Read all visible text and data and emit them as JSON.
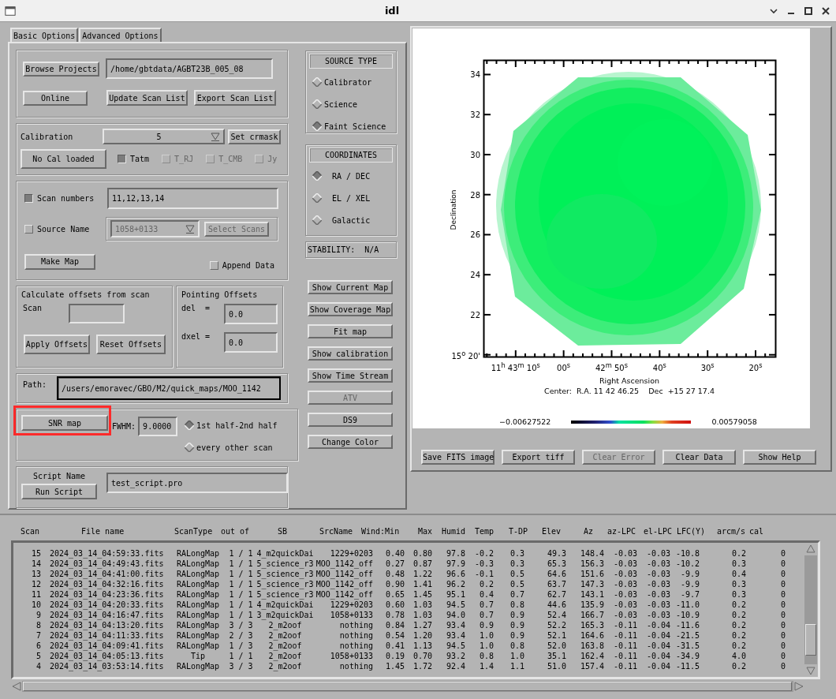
{
  "window": {
    "title": "idl"
  },
  "tabs": [
    {
      "label": "Basic Options",
      "selected": true
    },
    {
      "label": "Advanced Options",
      "selected": false
    }
  ],
  "project": {
    "browse_button": "Browse Projects",
    "path": "/home/gbtdata/AGBT23B_005_08",
    "online_button": "Online",
    "update_button": "Update Scan List",
    "export_button": "Export Scan List"
  },
  "calibration": {
    "label": "Calibration",
    "value": "5",
    "crmask_button": "Set crmask",
    "cal_button": "No Cal loaded",
    "units": [
      {
        "label": "Tatm",
        "checked": true,
        "disabled": false
      },
      {
        "label": "T_RJ",
        "checked": false,
        "disabled": true
      },
      {
        "label": "T_CMB",
        "checked": false,
        "disabled": true
      },
      {
        "label": "Jy",
        "checked": false,
        "disabled": true
      }
    ]
  },
  "scan_numbers": {
    "label": "Scan numbers",
    "checked": true,
    "value": "11,12,13,14"
  },
  "source_name": {
    "label": "Source Name",
    "checked": false,
    "value": "1058+0133",
    "select_button": "Select Scans",
    "disabled": true
  },
  "make_map_button": "Make Map",
  "append_data": {
    "label": "Append Data",
    "checked": false
  },
  "offsets": {
    "title": "Calculate offsets from scan",
    "scan_label": "Scan",
    "apply_button": "Apply Offsets",
    "reset_button": "Reset Offsets"
  },
  "pointing": {
    "title": "Pointing Offsets",
    "fields": [
      {
        "label": "del  =",
        "value": "0.0"
      },
      {
        "label": "dxel =",
        "value": "0.0"
      }
    ]
  },
  "path": {
    "label": "Path:",
    "value": "/users/emoravec/GBO/M2/quick_maps/MOO_1142"
  },
  "snr": {
    "button": "SNR map",
    "highlighted": true,
    "fwhm_label": "FWHM:",
    "fwhm_value": "9.0000",
    "modes": [
      {
        "label": "1st half-2nd half",
        "selected": true
      },
      {
        "label": "every other scan",
        "selected": false
      }
    ]
  },
  "script": {
    "label": "Script Name",
    "value": "test_script.pro",
    "run_button": "Run Script"
  },
  "source_type": {
    "title": "SOURCE TYPE",
    "options": [
      {
        "label": "Calibrator",
        "selected": false
      },
      {
        "label": "Science",
        "selected": false
      },
      {
        "label": "Faint Science",
        "selected": true
      }
    ]
  },
  "coordinates": {
    "title": "COORDINATES",
    "options": [
      {
        "label": "RA / DEC",
        "selected": true
      },
      {
        "label": "EL / XEL",
        "selected": false
      },
      {
        "label": "Galactic",
        "selected": false
      }
    ]
  },
  "stability": "STABILITY:  N/A",
  "side_buttons": [
    {
      "label": "Show Current Map",
      "disabled": false
    },
    {
      "label": "Show Coverage Map",
      "disabled": false
    },
    {
      "label": "Fit map",
      "disabled": false
    },
    {
      "label": "Show calibration",
      "disabled": false
    },
    {
      "label": "Show Time Stream",
      "disabled": false
    },
    {
      "label": "ATV",
      "disabled": true
    },
    {
      "label": "DS9",
      "disabled": false
    },
    {
      "label": "Change Color",
      "disabled": false
    }
  ],
  "map_plot": {
    "ylabel": "Declination",
    "xlabel": "Right Ascension",
    "yticks": [
      "34",
      "32",
      "30",
      "28",
      "26",
      "24",
      "22",
      "15$^{o}$ 20'"
    ],
    "xticks": [
      "11$^{h}$ 43$^{m}$ 10$^{s}$",
      "00$^{s}$",
      "42$^{m}$ 50$^{s}$",
      "40$^{s}$",
      "30$^{s}$",
      "20$^{s}$"
    ],
    "center": "Center:  R.A. 11 42 46.25    Dec  +15 27 17.4",
    "colorbar": {
      "min": "−0.00627522",
      "max": "0.00579058"
    }
  },
  "plot_buttons": [
    {
      "label": "Save FITS image",
      "disabled": false
    },
    {
      "label": "Export tiff",
      "disabled": false
    },
    {
      "label": "Clear Error",
      "disabled": true
    },
    {
      "label": "Clear Data",
      "disabled": false
    },
    {
      "label": "Show Help",
      "disabled": false
    }
  ],
  "scan_table": {
    "columns": [
      "Scan",
      "File name",
      "ScanType",
      "out of",
      "SB",
      "SrcName",
      "Wind:Min",
      "Max",
      "Humid",
      "Temp",
      "T-DP",
      "Elev",
      "Az",
      "az-LPC",
      "el-LPC",
      "LFC(Y)",
      "arcm/s",
      "cal"
    ],
    "rows": [
      [
        "15",
        "2024_03_14_04:59:33.fits",
        "RALongMap",
        "1 / 1",
        "4_m2quickDai",
        "1229+0203",
        "0.40",
        "0.80",
        "97.8",
        "-0.2",
        "0.3",
        "49.3",
        "148.4",
        "-0.03",
        "-0.03",
        "-10.8",
        "0.2",
        "0"
      ],
      [
        "14",
        "2024_03_14_04:49:43.fits",
        "RALongMap",
        "1 / 1",
        "5_science_r3",
        "MOO_1142_off",
        "0.27",
        "0.87",
        "97.9",
        "-0.3",
        "0.3",
        "65.3",
        "156.3",
        "-0.03",
        "-0.03",
        "-10.2",
        "0.3",
        "0"
      ],
      [
        "13",
        "2024_03_14_04:41:00.fits",
        "RALongMap",
        "1 / 1",
        "5_science_r3",
        "MOO_1142_off",
        "0.48",
        "1.22",
        "96.6",
        "-0.1",
        "0.5",
        "64.6",
        "151.6",
        "-0.03",
        "-0.03",
        "-9.9",
        "0.4",
        "0"
      ],
      [
        "12",
        "2024_03_14_04:32:16.fits",
        "RALongMap",
        "1 / 1",
        "5_science_r3",
        "MOO_1142_off",
        "0.90",
        "1.41",
        "96.2",
        "0.2",
        "0.5",
        "63.7",
        "147.3",
        "-0.03",
        "-0.03",
        "-9.9",
        "0.3",
        "0"
      ],
      [
        "11",
        "2024_03_14_04:23:36.fits",
        "RALongMap",
        "1 / 1",
        "5_science_r3",
        "MOO_1142_off",
        "0.65",
        "1.45",
        "95.1",
        "0.4",
        "0.7",
        "62.7",
        "143.1",
        "-0.03",
        "-0.03",
        "-9.7",
        "0.3",
        "0"
      ],
      [
        "10",
        "2024_03_14_04:20:33.fits",
        "RALongMap",
        "1 / 1",
        "4_m2quickDai",
        "1229+0203",
        "0.60",
        "1.03",
        "94.5",
        "0.7",
        "0.8",
        "44.6",
        "135.9",
        "-0.03",
        "-0.03",
        "-11.0",
        "0.2",
        "0"
      ],
      [
        "9",
        "2024_03_14_04:16:47.fits",
        "RALongMap",
        "1 / 1",
        "3_m2quickDai",
        "1058+0133",
        "0.78",
        "1.03",
        "94.0",
        "0.7",
        "0.9",
        "52.4",
        "166.7",
        "-0.03",
        "-0.03",
        "-10.9",
        "0.2",
        "0"
      ],
      [
        "8",
        "2024_03_14_04:13:20.fits",
        "RALongMap",
        "3 / 3",
        "2_m2oof",
        "nothing",
        "0.84",
        "1.27",
        "93.4",
        "0.9",
        "0.9",
        "52.2",
        "165.3",
        "-0.11",
        "-0.04",
        "-11.6",
        "0.2",
        "0"
      ],
      [
        "7",
        "2024_03_14_04:11:33.fits",
        "RALongMap",
        "2 / 3",
        "2_m2oof",
        "nothing",
        "0.54",
        "1.20",
        "93.4",
        "1.0",
        "0.9",
        "52.1",
        "164.6",
        "-0.11",
        "-0.04",
        "-21.5",
        "0.2",
        "0"
      ],
      [
        "6",
        "2024_03_14_04:09:41.fits",
        "RALongMap",
        "1 / 3",
        "2_m2oof",
        "nothing",
        "0.41",
        "1.13",
        "94.5",
        "1.0",
        "0.8",
        "52.0",
        "163.8",
        "-0.11",
        "-0.04",
        "-31.5",
        "0.2",
        "0"
      ],
      [
        "5",
        "2024_03_14_04:05:13.fits",
        "Tip",
        "1 / 1",
        "2_m2oof",
        "1058+0133",
        "0.19",
        "0.70",
        "93.2",
        "0.8",
        "1.0",
        "35.1",
        "162.4",
        "-0.11",
        "-0.04",
        "-34.9",
        "4.0",
        "0"
      ],
      [
        "4",
        "2024_03_14_03:53:14.fits",
        "RALongMap",
        "3 / 3",
        "2_m2oof",
        "nothing",
        "1.45",
        "1.72",
        "92.4",
        "1.4",
        "1.1",
        "51.0",
        "157.4",
        "-0.11",
        "-0.04",
        "-11.5",
        "0.2",
        "0"
      ]
    ]
  }
}
